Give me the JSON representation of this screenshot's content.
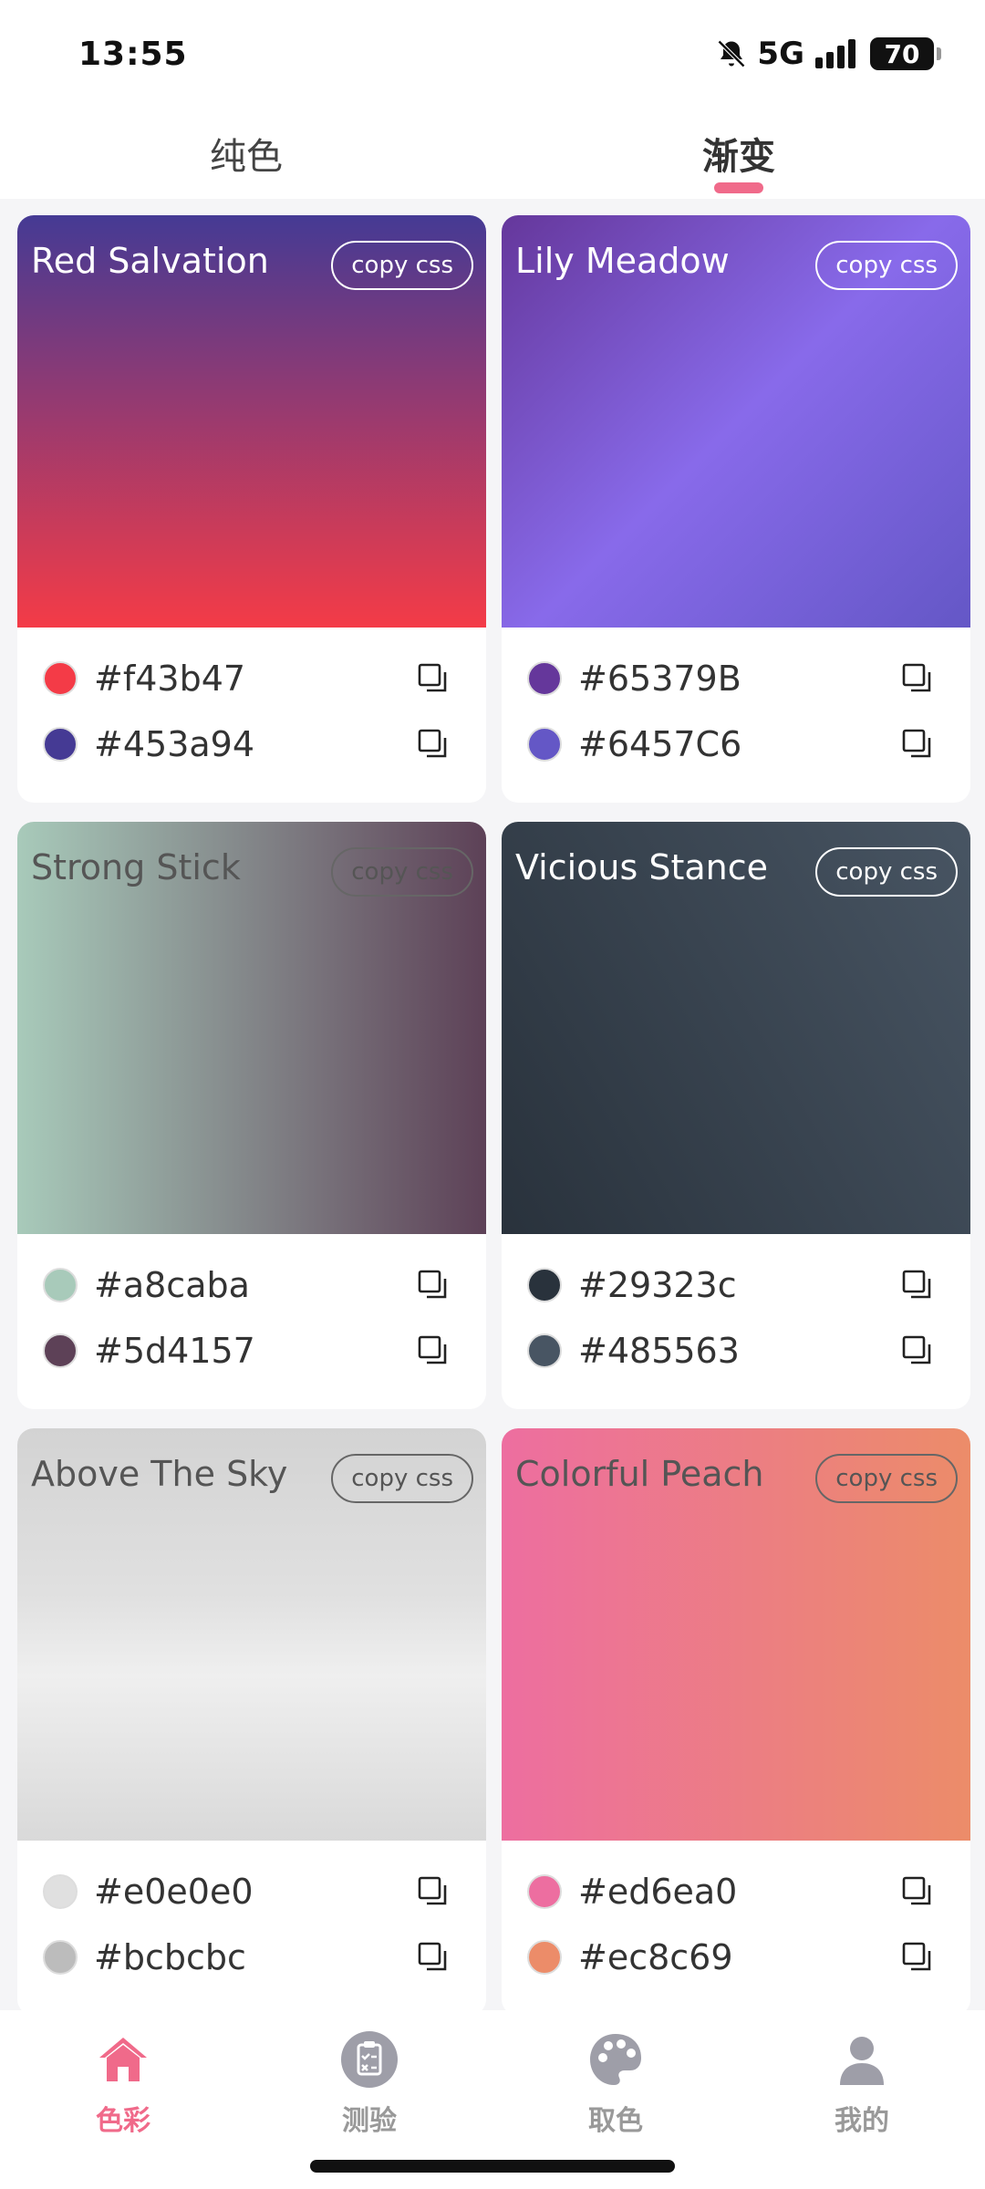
{
  "status": {
    "time": "13:55",
    "network": "5G",
    "battery": "70"
  },
  "tabs": [
    {
      "label": "纯色",
      "active": false
    },
    {
      "label": "渐变",
      "active": true
    }
  ],
  "copy_css_label": "copy css",
  "cards": [
    {
      "title": "Red Salvation",
      "gradient": "linear-gradient(to bottom, #453a94, #f43b47)",
      "dark_text": false,
      "colors": [
        {
          "hex": "#f43b47"
        },
        {
          "hex": "#453a94"
        }
      ]
    },
    {
      "title": "Lily Meadow",
      "gradient": "linear-gradient(135deg, #65379b 0%, #886aea 50%, #6457c6 100%)",
      "dark_text": false,
      "colors": [
        {
          "hex": "#65379B"
        },
        {
          "hex": "#6457C6"
        }
      ]
    },
    {
      "title": "Strong Stick",
      "gradient": "linear-gradient(to right, #a8caba, #5d4157)",
      "dark_text": true,
      "colors": [
        {
          "hex": "#a8caba"
        },
        {
          "hex": "#5d4157"
        }
      ]
    },
    {
      "title": "Vicious Stance",
      "gradient": "linear-gradient(60deg, #29323c, #485563)",
      "dark_text": false,
      "colors": [
        {
          "hex": "#29323c"
        },
        {
          "hex": "#485563"
        }
      ]
    },
    {
      "title": "Above The Sky",
      "gradient": "linear-gradient(to bottom, #d3d3d3 0%, #e0e0e0 40%, #efefef 60%, #d9d9d9 100%)",
      "dark_text": true,
      "colors": [
        {
          "hex": "#e0e0e0"
        },
        {
          "hex": "#bcbcbc"
        }
      ]
    },
    {
      "title": "Colorful Peach",
      "gradient": "linear-gradient(to right, #ed6ea0, #ec8c69)",
      "dark_text": true,
      "colors": [
        {
          "hex": "#ed6ea0"
        },
        {
          "hex": "#ec8c69"
        }
      ]
    }
  ],
  "nav": [
    {
      "label": "色彩",
      "icon": "home-icon",
      "active": true
    },
    {
      "label": "测验",
      "icon": "clipboard-icon",
      "active": false
    },
    {
      "label": "取色",
      "icon": "palette-icon",
      "active": false
    },
    {
      "label": "我的",
      "icon": "user-icon",
      "active": false
    }
  ],
  "colors": {
    "accent": "#f06a8a",
    "nav_inactive": "#9e9ea8"
  }
}
